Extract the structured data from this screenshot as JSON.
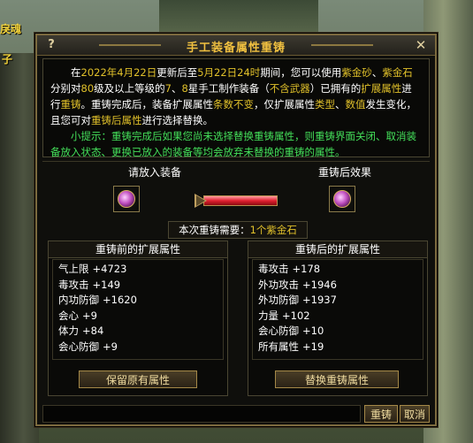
{
  "background": {
    "label_left_top": "戾魂",
    "label_left_mid": "子"
  },
  "window": {
    "title": "手工装备属性重铸",
    "help_label": "?",
    "close_label": "✕"
  },
  "notice": {
    "p1": [
      {
        "t": "在",
        "c": "w"
      },
      {
        "t": "2022年4月22日",
        "c": "y"
      },
      {
        "t": "更新后至",
        "c": "w"
      },
      {
        "t": "5月22日24时",
        "c": "y"
      },
      {
        "t": "期间，您可以使用",
        "c": "w"
      },
      {
        "t": "紫金砂",
        "c": "y"
      },
      {
        "t": "、",
        "c": "w"
      },
      {
        "t": "紫金石",
        "c": "y"
      },
      {
        "t": "分别对",
        "c": "w"
      },
      {
        "t": "80",
        "c": "y"
      },
      {
        "t": "级及以上等级的",
        "c": "w"
      },
      {
        "t": "7",
        "c": "y"
      },
      {
        "t": "、",
        "c": "w"
      },
      {
        "t": "8",
        "c": "y"
      },
      {
        "t": "星手工制作装备（",
        "c": "w"
      },
      {
        "t": "不含武器",
        "c": "y"
      },
      {
        "t": "）已拥有的",
        "c": "w"
      },
      {
        "t": "扩展属性",
        "c": "y"
      },
      {
        "t": "进行",
        "c": "w"
      },
      {
        "t": "重铸",
        "c": "y"
      },
      {
        "t": "。重铸完成后，装备扩展属性",
        "c": "w"
      },
      {
        "t": "条数不变",
        "c": "y"
      },
      {
        "t": "，仅扩展属性",
        "c": "w"
      },
      {
        "t": "类型",
        "c": "y"
      },
      {
        "t": "、",
        "c": "w"
      },
      {
        "t": "数值",
        "c": "y"
      },
      {
        "t": "发生变化，且您可对",
        "c": "w"
      },
      {
        "t": "重铸后属性",
        "c": "y"
      },
      {
        "t": "进行选择替换。",
        "c": "w"
      }
    ],
    "p2": "小提示：重铸完成后如果您尚未选择替换重铸属性，则重铸界面关闭、取消装备放入状态、更换已放入的装备等均会放弃未替换的重铸的属性。"
  },
  "slots": {
    "put_label": "请放入装备",
    "result_label": "重铸后效果",
    "put_icon": "amulet-icon",
    "result_icon": "amulet-icon"
  },
  "cost": {
    "prefix": "本次重铸需要：",
    "amount": "1个紫金石"
  },
  "before": {
    "title": "重铸前的扩展属性",
    "attrs": [
      {
        "name": "气上限",
        "value": "+4723"
      },
      {
        "name": "毒攻击",
        "value": "+149"
      },
      {
        "name": "内功防御",
        "value": "+1620"
      },
      {
        "name": "会心",
        "value": "+9"
      },
      {
        "name": "体力",
        "value": "+84"
      },
      {
        "name": "会心防御",
        "value": "+9"
      }
    ],
    "button": "保留原有属性"
  },
  "after": {
    "title": "重铸后的扩展属性",
    "attrs": [
      {
        "name": "毒攻击",
        "value": "+178"
      },
      {
        "name": "外功攻击",
        "value": "+1946"
      },
      {
        "name": "外功防御",
        "value": "+1937"
      },
      {
        "name": "力量",
        "value": "+102"
      },
      {
        "name": "会心防御",
        "value": "+10"
      },
      {
        "name": "所有属性",
        "value": "+19"
      }
    ],
    "button": "替换重铸属性"
  },
  "footer": {
    "input_value": "",
    "recast_label": "重铸",
    "cancel_label": "取消"
  },
  "colors": {
    "highlight_yellow": "#e0c02a",
    "highlight_green": "#44e05a",
    "title_gold": "#f0c040",
    "frame": "#7c6a3e"
  }
}
